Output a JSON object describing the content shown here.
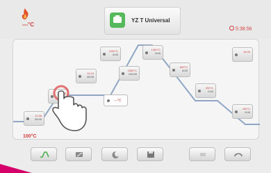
{
  "header": {
    "temperature_label": "---°C",
    "program_title": "YZ T Universal",
    "clock": "5:38:56"
  },
  "chart": {
    "start_temp": "100°C",
    "segments": [
      {
        "top": "11:36",
        "bottom": "20:00"
      },
      {
        "top": "11:18",
        "bottom": "21:58"
      },
      {
        "top": "11:19",
        "bottom": "40:00"
      },
      {
        "top": "1200°C",
        "bottom": "5:00"
      },
      {
        "top": "1550°C",
        "bottom": "120:00"
      },
      {
        "top": "1300°C",
        "bottom": "5:00"
      },
      {
        "top": "600°C",
        "bottom": "6:00"
      },
      {
        "top": "200°C",
        "bottom": "0:00"
      },
      {
        "top": "100°C",
        "bottom": "0:00"
      },
      {
        "top": "15:00",
        "bottom": ""
      }
    ],
    "active_label": "---°C"
  },
  "icons": {
    "flame": "flame-icon",
    "program": "program-icon",
    "clock": "clock-icon",
    "hand": "touch-hand-icon"
  },
  "colors": {
    "accent_red": "#d23c3c",
    "program_green": "#55b85b",
    "corner_magenta": "#d5006a"
  }
}
